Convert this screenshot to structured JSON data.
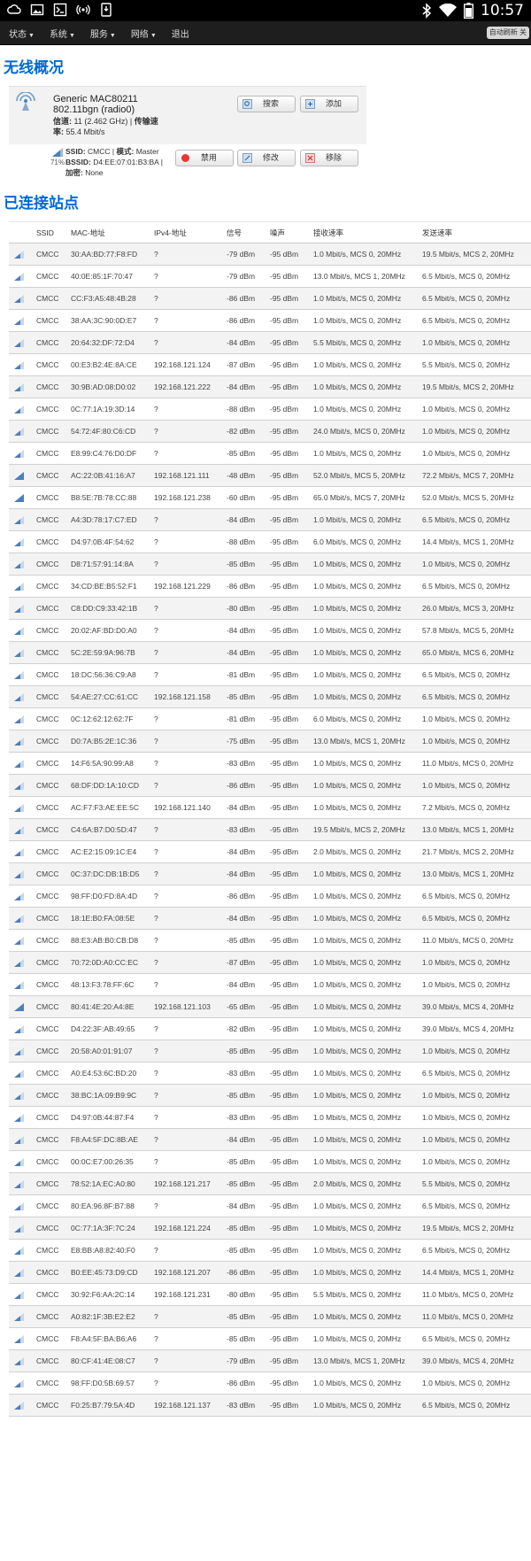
{
  "statusbar": {
    "time": "10:57"
  },
  "nav": {
    "items": [
      {
        "label": "状态",
        "dropdown": true
      },
      {
        "label": "系统",
        "dropdown": true
      },
      {
        "label": "服务",
        "dropdown": true
      },
      {
        "label": "网络",
        "dropdown": true
      },
      {
        "label": "退出",
        "dropdown": false
      }
    ],
    "autorefresh": "自动刷新 关"
  },
  "overview": {
    "title": "无线概况",
    "radio": {
      "name": "Generic MAC80211",
      "mode": "802.11bgn (radio0)",
      "channel_label": "信道:",
      "channel_value": "11 (2.462 GHz)",
      "rate_label": "传输速率:",
      "rate_value": "55.4 Mbit/s"
    },
    "buttons": {
      "scan": "搜索",
      "add": "添加",
      "disable": "禁用",
      "edit": "修改",
      "remove": "移除"
    },
    "network": {
      "signal_pct": "71%",
      "ssid_label": "SSID:",
      "ssid_value": "CMCC",
      "mode_label": "模式:",
      "mode_value": "Master",
      "bssid_label": "BSSID:",
      "bssid_value": "D4:EE:07:01:B3:BA",
      "enc_label": "加密:",
      "enc_value": "None"
    }
  },
  "stations": {
    "title": "已连接站点",
    "headers": {
      "ssid": "SSID",
      "mac": "MAC-地址",
      "ip": "IPv4-地址",
      "signal": "信号",
      "noise": "噪声",
      "rx": "接收速率",
      "tx": "发送速率"
    },
    "rows": [
      [
        "CMCC",
        "30:AA:BD:77:F8:FD",
        "?",
        "-79 dBm",
        "-95 dBm",
        "1.0 Mbit/s, MCS 0, 20MHz",
        "19.5 Mbit/s, MCS 2, 20MHz"
      ],
      [
        "CMCC",
        "40:0E:85:1F:70:47",
        "?",
        "-79 dBm",
        "-95 dBm",
        "13.0 Mbit/s, MCS 1, 20MHz",
        "6.5 Mbit/s, MCS 0, 20MHz"
      ],
      [
        "CMCC",
        "CC:F3:A5:48:4B:28",
        "?",
        "-86 dBm",
        "-95 dBm",
        "1.0 Mbit/s, MCS 0, 20MHz",
        "6.5 Mbit/s, MCS 0, 20MHz"
      ],
      [
        "CMCC",
        "38:AA:3C:90:0D:E7",
        "?",
        "-86 dBm",
        "-95 dBm",
        "1.0 Mbit/s, MCS 0, 20MHz",
        "6.5 Mbit/s, MCS 0, 20MHz"
      ],
      [
        "CMCC",
        "20:64:32:DF:72:D4",
        "?",
        "-84 dBm",
        "-95 dBm",
        "5.5 Mbit/s, MCS 0, 20MHz",
        "1.0 Mbit/s, MCS 0, 20MHz"
      ],
      [
        "CMCC",
        "00:E3:B2:4E:8A:CE",
        "192.168.121.124",
        "-87 dBm",
        "-95 dBm",
        "1.0 Mbit/s, MCS 0, 20MHz",
        "5.5 Mbit/s, MCS 0, 20MHz"
      ],
      [
        "CMCC",
        "30:9B:AD:08:D0:02",
        "192.168.121.222",
        "-84 dBm",
        "-95 dBm",
        "1.0 Mbit/s, MCS 0, 20MHz",
        "19.5 Mbit/s, MCS 2, 20MHz"
      ],
      [
        "CMCC",
        "0C:77:1A:19:3D:14",
        "?",
        "-88 dBm",
        "-95 dBm",
        "1.0 Mbit/s, MCS 0, 20MHz",
        "1.0 Mbit/s, MCS 0, 20MHz"
      ],
      [
        "CMCC",
        "54:72:4F:80:C6:CD",
        "?",
        "-82 dBm",
        "-95 dBm",
        "24.0 Mbit/s, MCS 0, 20MHz",
        "1.0 Mbit/s, MCS 0, 20MHz"
      ],
      [
        "CMCC",
        "E8:99:C4:76:D0:DF",
        "?",
        "-85 dBm",
        "-95 dBm",
        "1.0 Mbit/s, MCS 0, 20MHz",
        "1.0 Mbit/s, MCS 0, 20MHz"
      ],
      [
        "CMCC",
        "AC:22:0B:41:16:A7",
        "192.168.121.111",
        "-48 dBm",
        "-95 dBm",
        "52.0 Mbit/s, MCS 5, 20MHz",
        "72.2 Mbit/s, MCS 7, 20MHz"
      ],
      [
        "CMCC",
        "B8:5E:7B:78:CC:88",
        "192.168.121.238",
        "-60 dBm",
        "-95 dBm",
        "65.0 Mbit/s, MCS 7, 20MHz",
        "52.0 Mbit/s, MCS 5, 20MHz"
      ],
      [
        "CMCC",
        "A4:3D:78:17:C7:ED",
        "?",
        "-84 dBm",
        "-95 dBm",
        "1.0 Mbit/s, MCS 0, 20MHz",
        "6.5 Mbit/s, MCS 0, 20MHz"
      ],
      [
        "CMCC",
        "D4:97:0B:4F:54:62",
        "?",
        "-88 dBm",
        "-95 dBm",
        "6.0 Mbit/s, MCS 0, 20MHz",
        "14.4 Mbit/s, MCS 1, 20MHz"
      ],
      [
        "CMCC",
        "D8:71:57:91:14:8A",
        "?",
        "-85 dBm",
        "-95 dBm",
        "1.0 Mbit/s, MCS 0, 20MHz",
        "1.0 Mbit/s, MCS 0, 20MHz"
      ],
      [
        "CMCC",
        "34:CD:BE:B5:52:F1",
        "192.168.121.229",
        "-86 dBm",
        "-95 dBm",
        "1.0 Mbit/s, MCS 0, 20MHz",
        "6.5 Mbit/s, MCS 0, 20MHz"
      ],
      [
        "CMCC",
        "C8:DD:C9:33:42:1B",
        "?",
        "-80 dBm",
        "-95 dBm",
        "1.0 Mbit/s, MCS 0, 20MHz",
        "26.0 Mbit/s, MCS 3, 20MHz"
      ],
      [
        "CMCC",
        "20:02:AF:BD:D0:A0",
        "?",
        "-84 dBm",
        "-95 dBm",
        "1.0 Mbit/s, MCS 0, 20MHz",
        "57.8 Mbit/s, MCS 5, 20MHz"
      ],
      [
        "CMCC",
        "5C:2E:59:9A:96:7B",
        "?",
        "-84 dBm",
        "-95 dBm",
        "1.0 Mbit/s, MCS 0, 20MHz",
        "65.0 Mbit/s, MCS 6, 20MHz"
      ],
      [
        "CMCC",
        "18:DC:56:36:C9:A8",
        "?",
        "-81 dBm",
        "-95 dBm",
        "1.0 Mbit/s, MCS 0, 20MHz",
        "6.5 Mbit/s, MCS 0, 20MHz"
      ],
      [
        "CMCC",
        "54:AE:27:CC:61:CC",
        "192.168.121.158",
        "-85 dBm",
        "-95 dBm",
        "1.0 Mbit/s, MCS 0, 20MHz",
        "6.5 Mbit/s, MCS 0, 20MHz"
      ],
      [
        "CMCC",
        "0C:12:62:12:62:7F",
        "?",
        "-81 dBm",
        "-95 dBm",
        "6.0 Mbit/s, MCS 0, 20MHz",
        "1.0 Mbit/s, MCS 0, 20MHz"
      ],
      [
        "CMCC",
        "D0:7A:B5:2E:1C:36",
        "?",
        "-75 dBm",
        "-95 dBm",
        "13.0 Mbit/s, MCS 1, 20MHz",
        "1.0 Mbit/s, MCS 0, 20MHz"
      ],
      [
        "CMCC",
        "14:F6:5A:90:99:A8",
        "?",
        "-83 dBm",
        "-95 dBm",
        "1.0 Mbit/s, MCS 0, 20MHz",
        "11.0 Mbit/s, MCS 0, 20MHz"
      ],
      [
        "CMCC",
        "68:DF:DD:1A:10:CD",
        "?",
        "-86 dBm",
        "-95 dBm",
        "1.0 Mbit/s, MCS 0, 20MHz",
        "1.0 Mbit/s, MCS 0, 20MHz"
      ],
      [
        "CMCC",
        "AC:F7:F3:AE:EE:5C",
        "192.168.121.140",
        "-84 dBm",
        "-95 dBm",
        "1.0 Mbit/s, MCS 0, 20MHz",
        "7.2 Mbit/s, MCS 0, 20MHz"
      ],
      [
        "CMCC",
        "C4:6A:B7:D0:5D:47",
        "?",
        "-83 dBm",
        "-95 dBm",
        "19.5 Mbit/s, MCS 2, 20MHz",
        "13.0 Mbit/s, MCS 1, 20MHz"
      ],
      [
        "CMCC",
        "AC:E2:15:09:1C:E4",
        "?",
        "-84 dBm",
        "-95 dBm",
        "2.0 Mbit/s, MCS 0, 20MHz",
        "21.7 Mbit/s, MCS 2, 20MHz"
      ],
      [
        "CMCC",
        "0C:37:DC:DB:1B:D5",
        "?",
        "-84 dBm",
        "-95 dBm",
        "1.0 Mbit/s, MCS 0, 20MHz",
        "13.0 Mbit/s, MCS 1, 20MHz"
      ],
      [
        "CMCC",
        "98:FF:D0:FD:8A:4D",
        "?",
        "-86 dBm",
        "-95 dBm",
        "1.0 Mbit/s, MCS 0, 20MHz",
        "6.5 Mbit/s, MCS 0, 20MHz"
      ],
      [
        "CMCC",
        "18:1E:B0:FA:08:5E",
        "?",
        "-84 dBm",
        "-95 dBm",
        "1.0 Mbit/s, MCS 0, 20MHz",
        "6.5 Mbit/s, MCS 0, 20MHz"
      ],
      [
        "CMCC",
        "88:E3:AB:B0:CB:D8",
        "?",
        "-85 dBm",
        "-95 dBm",
        "1.0 Mbit/s, MCS 0, 20MHz",
        "11.0 Mbit/s, MCS 0, 20MHz"
      ],
      [
        "CMCC",
        "70:72:0D:A0:CC:EC",
        "?",
        "-87 dBm",
        "-95 dBm",
        "1.0 Mbit/s, MCS 0, 20MHz",
        "1.0 Mbit/s, MCS 0, 20MHz"
      ],
      [
        "CMCC",
        "48:13:F3:78:FF:6C",
        "?",
        "-84 dBm",
        "-95 dBm",
        "1.0 Mbit/s, MCS 0, 20MHz",
        "1.0 Mbit/s, MCS 0, 20MHz"
      ],
      [
        "CMCC",
        "80:41:4E:20:A4:8E",
        "192.168.121.103",
        "-65 dBm",
        "-95 dBm",
        "1.0 Mbit/s, MCS 0, 20MHz",
        "39.0 Mbit/s, MCS 4, 20MHz"
      ],
      [
        "CMCC",
        "D4:22:3F:AB:49:65",
        "?",
        "-82 dBm",
        "-95 dBm",
        "1.0 Mbit/s, MCS 0, 20MHz",
        "39.0 Mbit/s, MCS 4, 20MHz"
      ],
      [
        "CMCC",
        "20:58:A0:01:91:07",
        "?",
        "-85 dBm",
        "-95 dBm",
        "1.0 Mbit/s, MCS 0, 20MHz",
        "1.0 Mbit/s, MCS 0, 20MHz"
      ],
      [
        "CMCC",
        "A0:E4:53:6C:BD:20",
        "?",
        "-83 dBm",
        "-95 dBm",
        "1.0 Mbit/s, MCS 0, 20MHz",
        "6.5 Mbit/s, MCS 0, 20MHz"
      ],
      [
        "CMCC",
        "38:BC:1A:09:B9:9C",
        "?",
        "-85 dBm",
        "-95 dBm",
        "1.0 Mbit/s, MCS 0, 20MHz",
        "1.0 Mbit/s, MCS 0, 20MHz"
      ],
      [
        "CMCC",
        "D4:97:0B:44:87:F4",
        "?",
        "-83 dBm",
        "-95 dBm",
        "1.0 Mbit/s, MCS 0, 20MHz",
        "1.0 Mbit/s, MCS 0, 20MHz"
      ],
      [
        "CMCC",
        "F8:A4:5F:DC:8B:AE",
        "?",
        "-84 dBm",
        "-95 dBm",
        "1.0 Mbit/s, MCS 0, 20MHz",
        "1.0 Mbit/s, MCS 0, 20MHz"
      ],
      [
        "CMCC",
        "00:0C:E7:00:26:35",
        "?",
        "-85 dBm",
        "-95 dBm",
        "1.0 Mbit/s, MCS 0, 20MHz",
        "1.0 Mbit/s, MCS 0, 20MHz"
      ],
      [
        "CMCC",
        "78:52:1A:EC:A0:80",
        "192.168.121.217",
        "-85 dBm",
        "-95 dBm",
        "2.0 Mbit/s, MCS 0, 20MHz",
        "5.5 Mbit/s, MCS 0, 20MHz"
      ],
      [
        "CMCC",
        "80:EA:96:8F:B7:88",
        "?",
        "-84 dBm",
        "-95 dBm",
        "1.0 Mbit/s, MCS 0, 20MHz",
        "6.5 Mbit/s, MCS 0, 20MHz"
      ],
      [
        "CMCC",
        "0C:77:1A:3F:7C:24",
        "192.168.121.224",
        "-85 dBm",
        "-95 dBm",
        "1.0 Mbit/s, MCS 0, 20MHz",
        "19.5 Mbit/s, MCS 2, 20MHz"
      ],
      [
        "CMCC",
        "E8:BB:A8:82:40:F0",
        "?",
        "-85 dBm",
        "-95 dBm",
        "1.0 Mbit/s, MCS 0, 20MHz",
        "6.5 Mbit/s, MCS 0, 20MHz"
      ],
      [
        "CMCC",
        "B0:EE:45:73:D9:CD",
        "192.168.121.207",
        "-86 dBm",
        "-95 dBm",
        "1.0 Mbit/s, MCS 0, 20MHz",
        "14.4 Mbit/s, MCS 1, 20MHz"
      ],
      [
        "CMCC",
        "30:92:F6:AA:2C:14",
        "192.168.121.231",
        "-80 dBm",
        "-95 dBm",
        "5.5 Mbit/s, MCS 0, 20MHz",
        "11.0 Mbit/s, MCS 0, 20MHz"
      ],
      [
        "CMCC",
        "A0:82:1F:3B:E2:E2",
        "?",
        "-85 dBm",
        "-95 dBm",
        "1.0 Mbit/s, MCS 0, 20MHz",
        "11.0 Mbit/s, MCS 0, 20MHz"
      ],
      [
        "CMCC",
        "F8:A4:5F:BA:B6:A6",
        "?",
        "-85 dBm",
        "-95 dBm",
        "1.0 Mbit/s, MCS 0, 20MHz",
        "6.5 Mbit/s, MCS 0, 20MHz"
      ],
      [
        "CMCC",
        "80:CF:41:4E:08:C7",
        "?",
        "-79 dBm",
        "-95 dBm",
        "13.0 Mbit/s, MCS 1, 20MHz",
        "39.0 Mbit/s, MCS 4, 20MHz"
      ],
      [
        "CMCC",
        "98:FF:D0:5B:69:57",
        "?",
        "-86 dBm",
        "-95 dBm",
        "1.0 Mbit/s, MCS 0, 20MHz",
        "1.0 Mbit/s, MCS 0, 20MHz"
      ],
      [
        "CMCC",
        "F0:25:B7:79:5A:4D",
        "192.168.121.137",
        "-83 dBm",
        "-95 dBm",
        "1.0 Mbit/s, MCS 0, 20MHz",
        "6.5 Mbit/s, MCS 0, 20MHz"
      ]
    ]
  },
  "colors": {
    "accent": "#0069d6",
    "navbar": "#1e1e1e",
    "signal_bar": "#4a7fbf"
  }
}
